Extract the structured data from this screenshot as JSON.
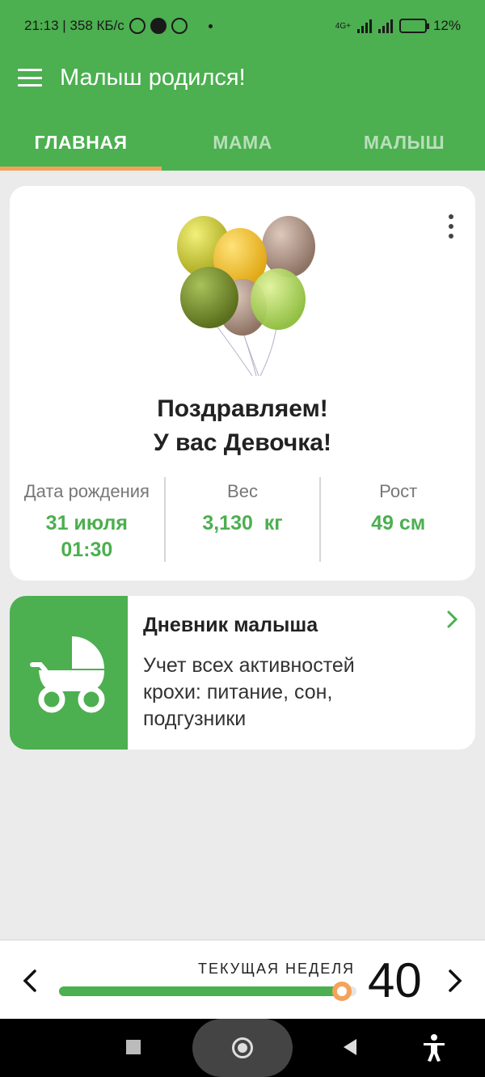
{
  "status_bar": {
    "time_speed": "21:13 | 358 КБ/с",
    "network_type": "4G+",
    "battery": "12%"
  },
  "app": {
    "title": "Малыш родился!",
    "icons": {
      "menu": "hamburger-menu-icon",
      "more": "more-vertical-icon"
    },
    "colors": {
      "primary": "#4caf50",
      "accent": "#f5a25a"
    }
  },
  "tabs": [
    {
      "label": "ГЛАВНАЯ",
      "active": true
    },
    {
      "label": "МАМА",
      "active": false
    },
    {
      "label": "МАЛЫШ",
      "active": false
    }
  ],
  "main_card": {
    "congrats_line1": "Поздравляем!",
    "congrats_line2": "У вас Девочка!",
    "image": "balloons-illustration",
    "stats": [
      {
        "label": "Дата рождения",
        "value_line1": "31 июля",
        "value_line2": "01:30"
      },
      {
        "label": "Вес",
        "value_line1": "3,130  кг"
      },
      {
        "label": "Рост",
        "value_line1": "49 см"
      }
    ]
  },
  "diary_card": {
    "title": "Дневник малыша",
    "description": "Учет всех активностей крохи: питание, сон, подгузники",
    "icon": "baby-stroller-icon"
  },
  "week_panel": {
    "label": "ТЕКУЩАЯ НЕДЕЛЯ",
    "week": "40",
    "progress": 0.95
  },
  "nav_bar": {
    "icons": [
      "recents-square-icon",
      "home-circle-icon",
      "back-triangle-icon",
      "accessibility-icon"
    ]
  }
}
